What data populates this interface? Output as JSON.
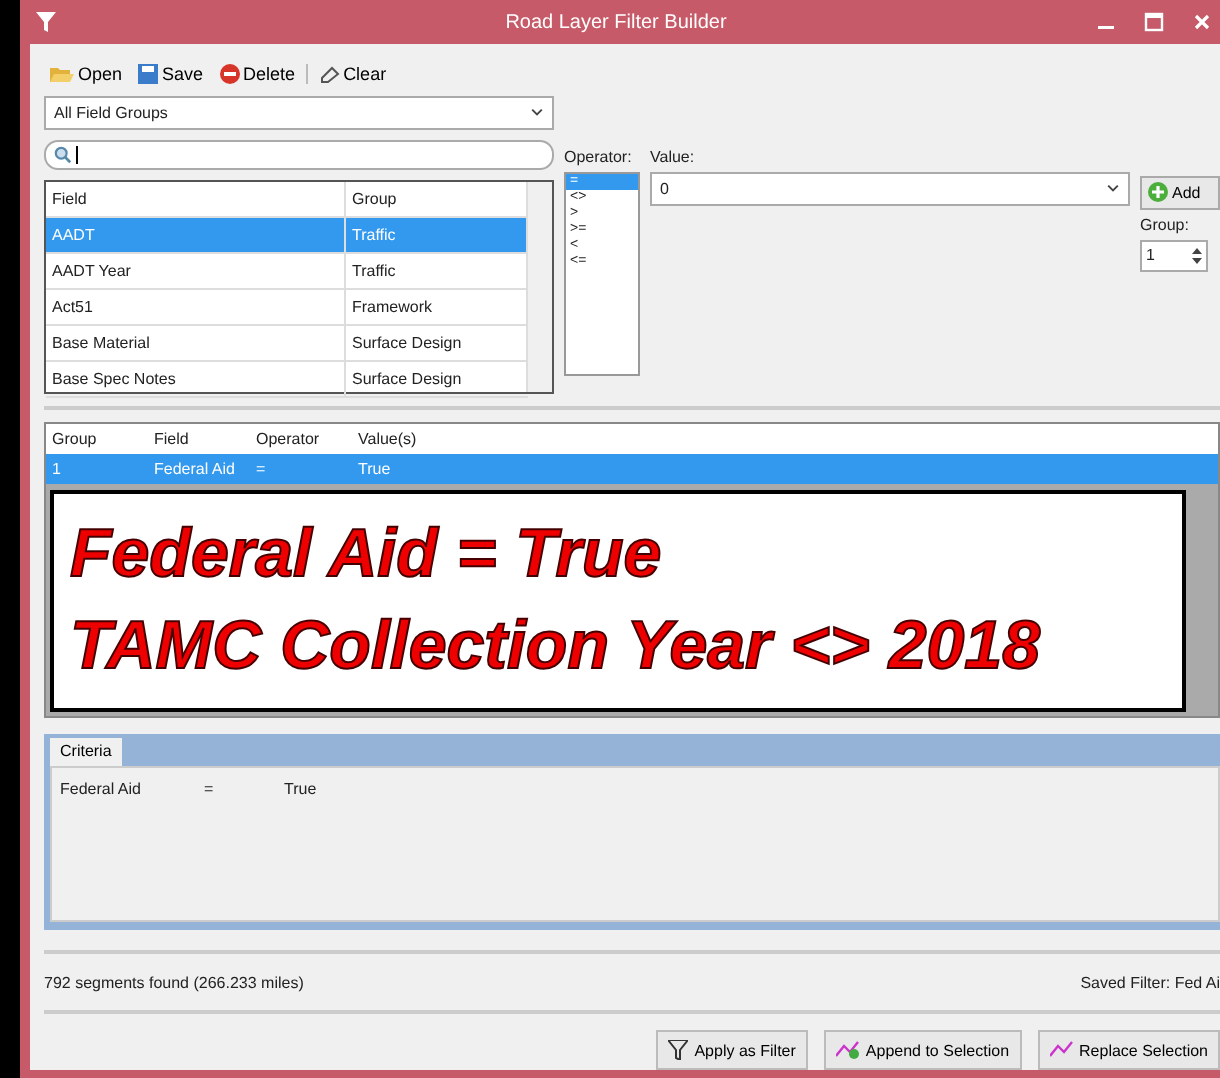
{
  "window": {
    "title": "Road Layer Filter Builder"
  },
  "toolbar": [
    {
      "label": "Open",
      "kind": "open"
    },
    {
      "label": "Save",
      "kind": "save"
    },
    {
      "label": "Delete",
      "kind": "delete"
    },
    {
      "label": "Clear",
      "kind": "clear"
    }
  ],
  "field_group_dropdown": {
    "value": "All Field Groups"
  },
  "field_list": {
    "columns": [
      "Field",
      "Group"
    ],
    "rows": [
      {
        "field": "AADT",
        "group": "Traffic",
        "selected": true
      },
      {
        "field": "AADT Year",
        "group": "Traffic",
        "selected": false
      },
      {
        "field": "Act51",
        "group": "Framework",
        "selected": false
      },
      {
        "field": "Base Material",
        "group": "Surface Design",
        "selected": false
      },
      {
        "field": "Base Spec Notes",
        "group": "Surface Design",
        "selected": false
      }
    ]
  },
  "operator": {
    "label": "Operator:",
    "items": [
      {
        "label": "=",
        "selected": true
      },
      {
        "label": "<>",
        "selected": false
      },
      {
        "label": ">",
        "selected": false
      },
      {
        "label": ">=",
        "selected": false
      },
      {
        "label": "<",
        "selected": false
      },
      {
        "label": "<=",
        "selected": false
      }
    ]
  },
  "value": {
    "label": "Value:",
    "value": "0"
  },
  "add_button": "Add",
  "group_spinner": {
    "label": "Group:",
    "value": "1"
  },
  "criteria_grid": {
    "columns": [
      "Group",
      "Field",
      "Operator",
      "Value(s)"
    ],
    "rows": [
      {
        "cells": [
          "1",
          "Federal Aid",
          "=",
          "True"
        ],
        "selected": true
      }
    ]
  },
  "annotation": {
    "lines": [
      "Federal Aid = True",
      "TAMC Collection Year <> 2018"
    ]
  },
  "criteria_tabs": [
    {
      "label": "Criteria",
      "selected": true
    }
  ],
  "criteria_text": [
    "Federal Aid",
    "=",
    "True"
  ],
  "status_bar": {
    "left": "792 segments found (266.233 miles)",
    "right": "Saved Filter: Fed Ai"
  },
  "buttons": [
    {
      "label": "Apply as Filter",
      "kind": "filter"
    },
    {
      "label": "Append to Selection",
      "kind": "append"
    },
    {
      "label": "Replace Selection",
      "kind": "replace"
    }
  ]
}
